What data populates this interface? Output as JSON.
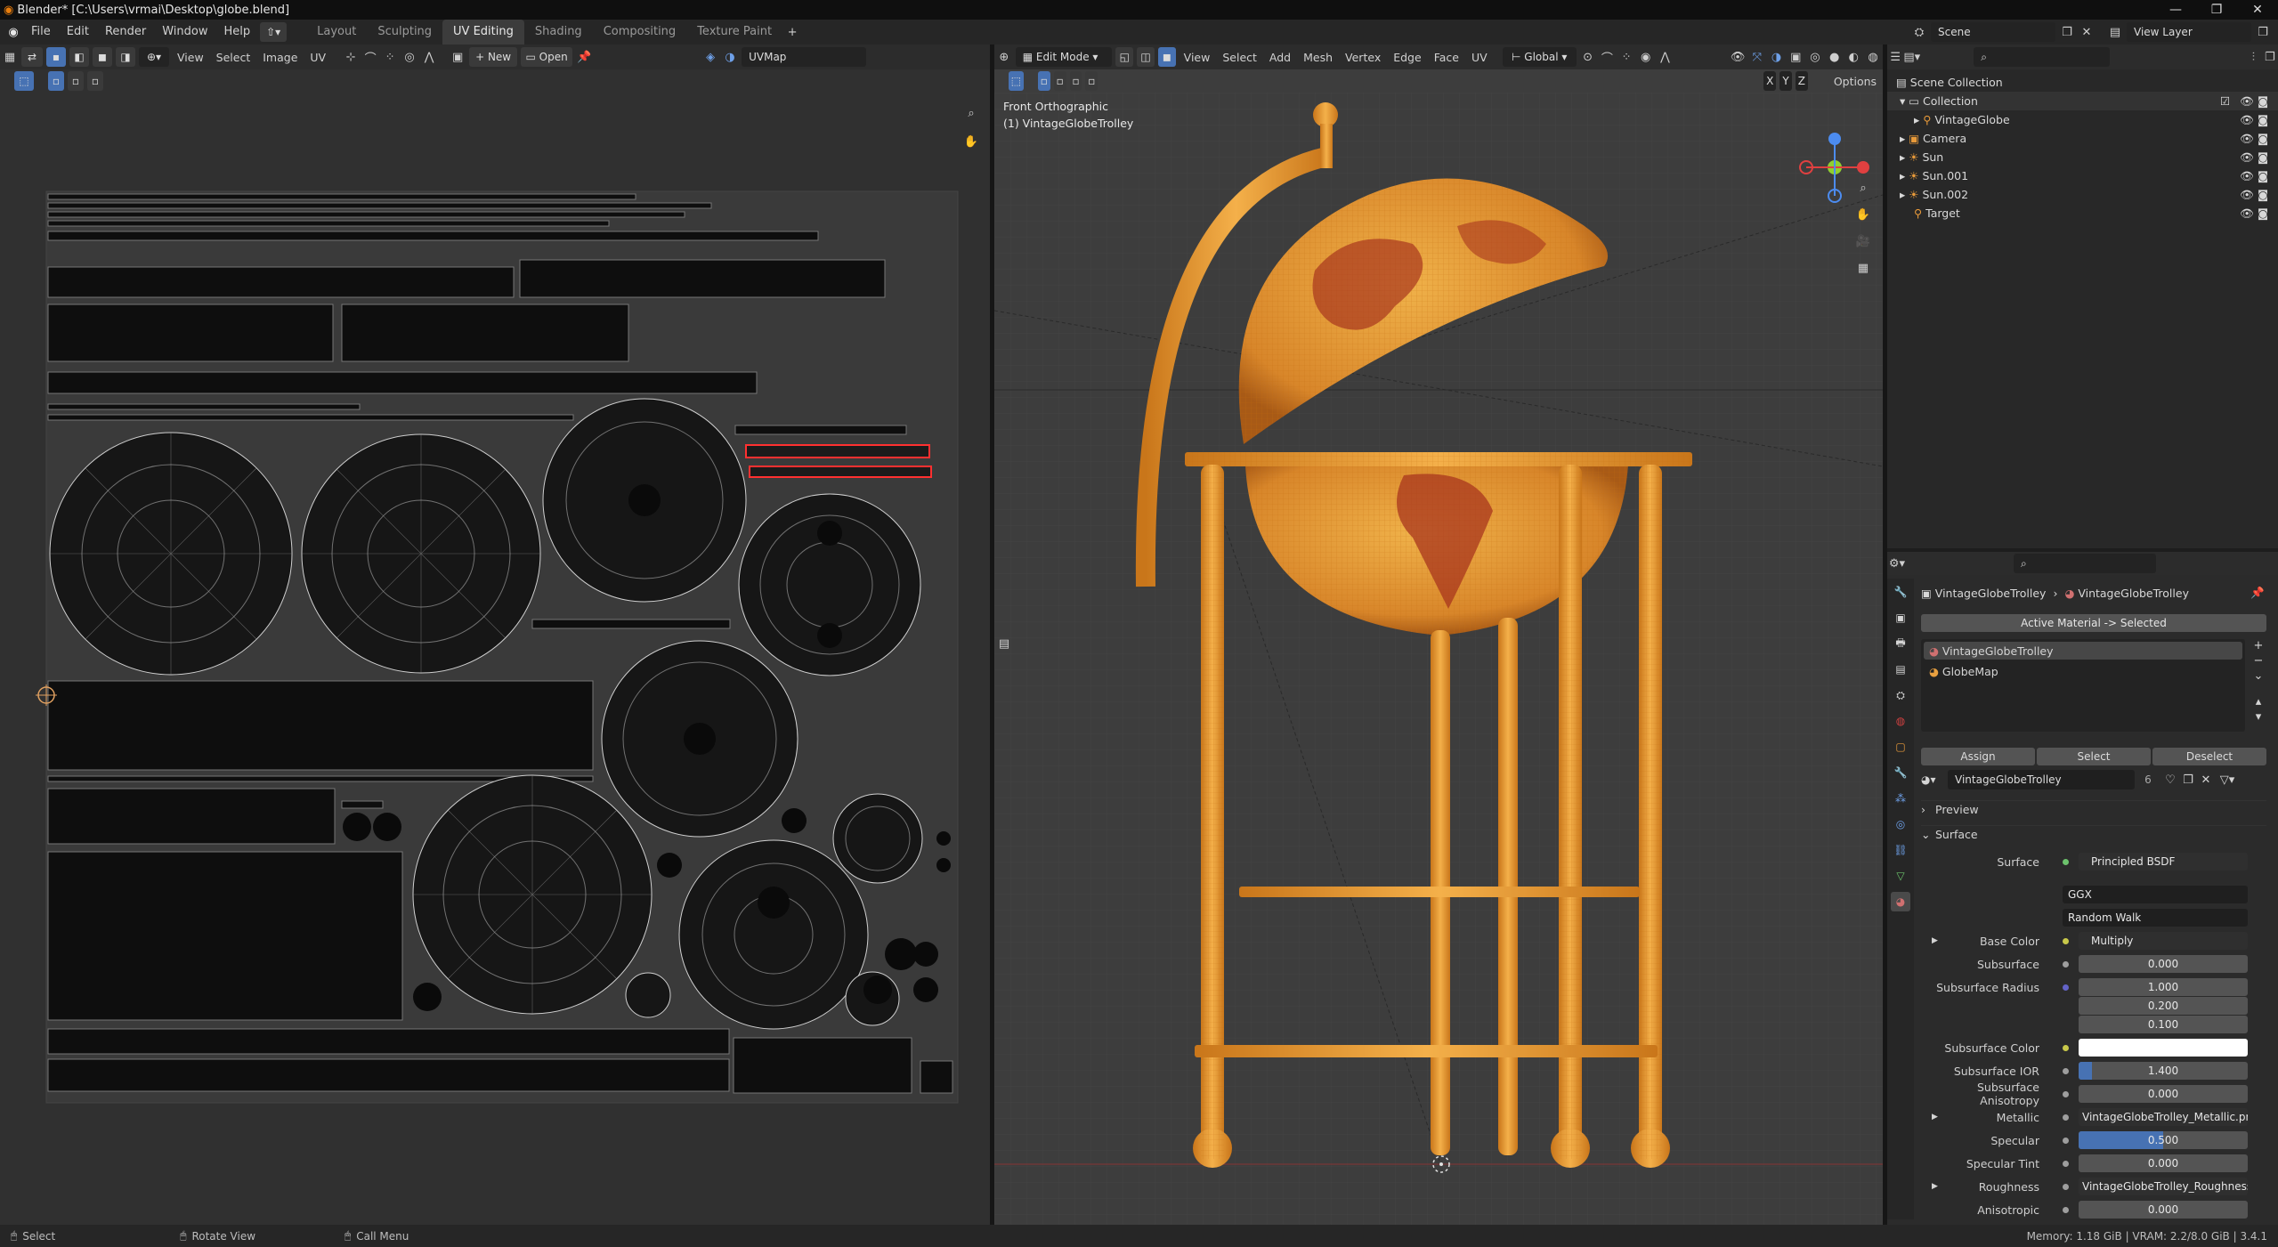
{
  "window": {
    "title": "Blender* [C:\\Users\\vrmai\\Desktop\\globe.blend]",
    "controls": [
      "—",
      "❐",
      "✕"
    ]
  },
  "menu": [
    "File",
    "Edit",
    "Render",
    "Window",
    "Help"
  ],
  "workspaces": [
    "Layout",
    "Sculpting",
    "UV Editing",
    "Shading",
    "Compositing",
    "Texture Paint"
  ],
  "active_workspace": "UV Editing",
  "scene": {
    "label": "Scene",
    "view_layer": "View Layer"
  },
  "uv_editor": {
    "menus": [
      "View",
      "Select",
      "Image",
      "UV"
    ],
    "new_label": "New",
    "open_label": "Open",
    "uvmap": "UVMap"
  },
  "viewport": {
    "mode": "Edit Mode",
    "menus": [
      "View",
      "Select",
      "Add",
      "Mesh",
      "Vertex",
      "Edge",
      "Face",
      "UV"
    ],
    "orientation": "Global",
    "options_label": "Options",
    "axes": [
      "X",
      "Y",
      "Z"
    ],
    "view_name": "Front Orthographic",
    "object_name": "(1) VintageGlobeTrolley"
  },
  "outliner": {
    "root": "Scene Collection",
    "items": [
      {
        "name": "Collection"
      },
      {
        "name": "VintageGlobe"
      },
      {
        "name": "Camera"
      },
      {
        "name": "Sun"
      },
      {
        "name": "Sun.001"
      },
      {
        "name": "Sun.002"
      },
      {
        "name": "Target"
      }
    ]
  },
  "properties": {
    "breadcrumb_object": "VintageGlobeTrolley",
    "breadcrumb_material": "VintageGlobeTrolley",
    "active_material_label": "Active Material -> Selected",
    "slots": [
      "VintageGlobeTrolley",
      "GlobeMap"
    ],
    "assign": "Assign",
    "select": "Select",
    "deselect": "Deselect",
    "material_name": "VintageGlobeTrolley",
    "material_users": "6",
    "preview": "Preview",
    "surface_section": "Surface",
    "rows": [
      {
        "label": "Surface",
        "value": "Principled BSDF",
        "color": "#6cc26c"
      },
      {
        "label": "",
        "value": "GGX"
      },
      {
        "label": "",
        "value": "Random Walk"
      },
      {
        "label": "Base Color",
        "value": "Multiply",
        "color": "#c8c84a"
      },
      {
        "label": "Subsurface",
        "value": "0.000",
        "color": "#9e9e9e"
      },
      {
        "label": "Subsurface Radius",
        "value": "1.000",
        "color": "#6363c7"
      },
      {
        "label": "",
        "value": "0.200"
      },
      {
        "label": "",
        "value": "0.100"
      },
      {
        "label": "Subsurface Color",
        "value": "",
        "color": "#c8c84a"
      },
      {
        "label": "Subsurface IOR",
        "value": "1.400",
        "color": "#9e9e9e"
      },
      {
        "label": "Subsurface Anisotropy",
        "value": "0.000",
        "color": "#9e9e9e"
      },
      {
        "label": "Metallic",
        "value": "VintageGlobeTrolley_Metallic.png",
        "color": "#9e9e9e"
      },
      {
        "label": "Specular",
        "value": "0.500",
        "color": "#9e9e9e"
      },
      {
        "label": "Specular Tint",
        "value": "0.000",
        "color": "#9e9e9e"
      },
      {
        "label": "Roughness",
        "value": "VintageGlobeTrolley_Roughness....",
        "color": "#9e9e9e"
      },
      {
        "label": "Anisotropic",
        "value": "0.000",
        "color": "#9e9e9e"
      }
    ],
    "subsurface_ior_fill": 0.08,
    "specular_fill": 0.5
  },
  "status": {
    "select": "Select",
    "rotate": "Rotate View",
    "call_menu": "Call Menu",
    "memory": "Memory: 1.18 GiB | VRAM: 2.2/8.0 GiB | 3.4.1"
  },
  "colors": {
    "accent": "#4772b3",
    "mesh": "#e8a43a",
    "selection": "#e02020"
  }
}
